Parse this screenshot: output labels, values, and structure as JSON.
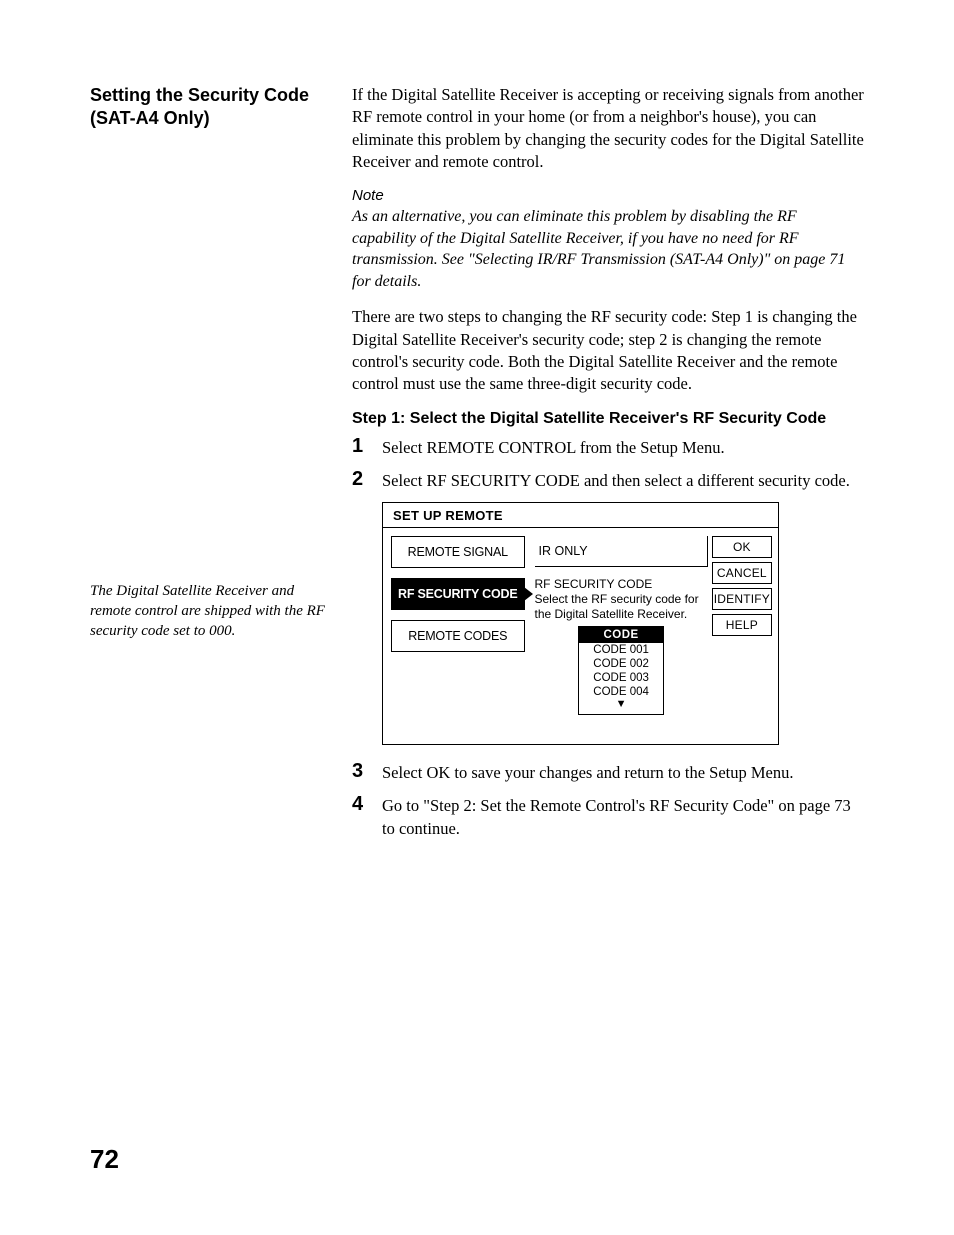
{
  "page_number": "72",
  "section_title": "Setting the Security Code (SAT-A4 Only)",
  "para1": "If the Digital Satellite Receiver is accepting or receiving signals from another RF remote control in your home (or from a neighbor's house), you can eliminate this problem by changing the security codes for the Digital Satellite Receiver and remote control.",
  "note_label": "Note",
  "note_text": "As an alternative, you can eliminate this problem by disabling the RF capability of the Digital Satellite Receiver, if you have no need for RF transmission. See \"Selecting IR/RF Transmission (SAT-A4 Only)\" on page 71 for details.",
  "para2": "There are two steps to changing the RF security code: Step 1 is changing the Digital Satellite Receiver's security code; step 2 is changing the remote control's security code. Both the Digital Satellite Receiver and the remote control must use the same three-digit security code.",
  "step1_heading": "Step 1: Select the Digital Satellite Receiver's RF Security Code",
  "steps_a": {
    "s1": {
      "num": "1",
      "text": "Select REMOTE CONTROL from the Setup Menu."
    },
    "s2": {
      "num": "2",
      "text": "Select RF SECURITY CODE and then select a different security code."
    }
  },
  "steps_b": {
    "s3": {
      "num": "3",
      "text": "Select OK to save your changes and return to the Setup Menu."
    },
    "s4": {
      "num": "4",
      "text": "Go to \"Step 2: Set the Remote Control's RF Security Code\" on page 73 to continue."
    }
  },
  "margin_note": "The Digital Satellite Receiver and remote control are shipped with the RF security code set to 000.",
  "osd": {
    "title": "SET UP REMOTE",
    "left_items": {
      "i1": "REMOTE SIGNAL",
      "i2": "RF SECURITY CODE",
      "i3": "REMOTE CODES"
    },
    "mid_ir": "IR ONLY",
    "desc_line1": "RF SECURITY CODE",
    "desc_rest": "Select the RF security code for the Digital Satellite Receiver.",
    "code_hdr": "CODE",
    "codes": {
      "c1": "CODE 001",
      "c2": "CODE 002",
      "c3": "CODE 003",
      "c4": "CODE 004"
    },
    "right_buttons": {
      "b1": "OK",
      "b2": "CANCEL",
      "b3": "IDENTIFY",
      "b4": "HELP"
    }
  }
}
